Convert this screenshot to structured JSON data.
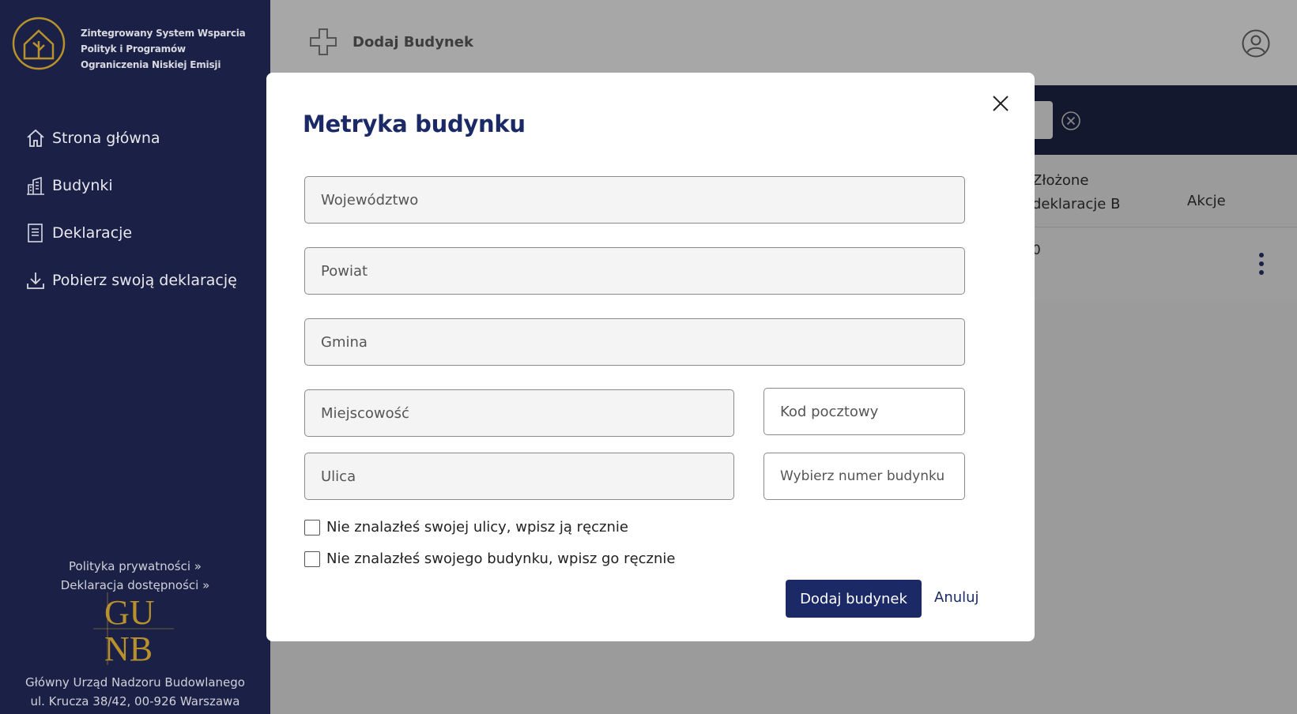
{
  "sidebar": {
    "brand_lines": [
      "Zintegrowany System Wsparcia",
      "Polityk i Programów",
      "Ograniczenia Niskiej Emisji"
    ],
    "items": [
      {
        "label": "Strona główna",
        "icon": "home-icon"
      },
      {
        "label": "Budynki",
        "icon": "buildings-icon"
      },
      {
        "label": "Deklaracje",
        "icon": "document-icon"
      },
      {
        "label": "Pobierz swoją deklarację",
        "icon": "download-icon"
      }
    ],
    "links": [
      "Polityka prywatności »",
      "Deklaracja dostępności »"
    ],
    "gunb_logo": [
      "GU",
      "NB"
    ],
    "address_lines": [
      "Główny Urząd Nadzoru Budowlanego",
      "ul. Krucza 38/42, 00-926 Warszawa"
    ]
  },
  "topbar": {
    "title": "Dodaj Budynek"
  },
  "table": {
    "col_declarations": [
      "Złożone",
      "deklaracje B"
    ],
    "col_actions": "Akcje",
    "row_value": "0"
  },
  "modal": {
    "title": "Metryka budynku",
    "fields": {
      "wojewodztwo": "Województwo",
      "powiat": "Powiat",
      "gmina": "Gmina",
      "miejscowosc": "Miejscowość",
      "kod": "Kod pocztowy",
      "ulica": "Ulica",
      "numer": "Wybierz numer budynku"
    },
    "checkbox_street": "Nie znalazłeś swojej ulicy, wpisz ją ręcznie",
    "checkbox_building": "Nie znalazłeś swojego budynku, wpisz go ręcznie",
    "submit": "Dodaj budynek",
    "cancel": "Anuluj"
  },
  "colors": {
    "sidebar_bg": "#1b2146",
    "accent_gold": "#b8912c",
    "primary": "#1b2a66"
  }
}
